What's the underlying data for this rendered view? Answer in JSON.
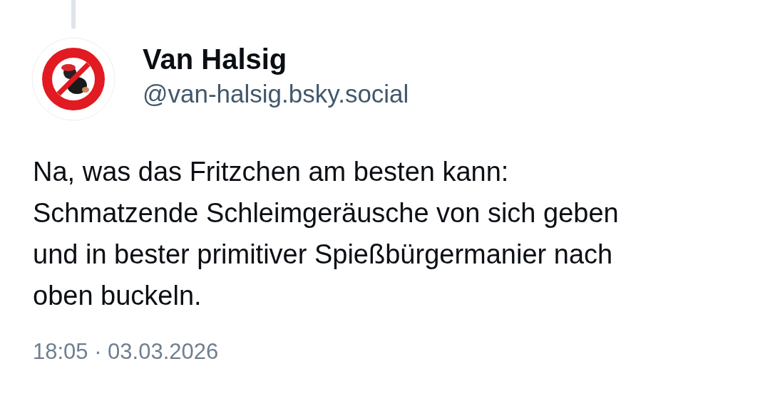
{
  "post": {
    "author": {
      "display_name": "Van Halsig",
      "handle": "@van-halsig.bsky.social"
    },
    "text": "Na, was das Fritzchen am besten kann: Schmatzende Schleimgeräusche von sich geben und in bester primitiver Spießbürgermanier nach oben buckeln.",
    "timestamp": "18:05 · 03.03.2026"
  }
}
